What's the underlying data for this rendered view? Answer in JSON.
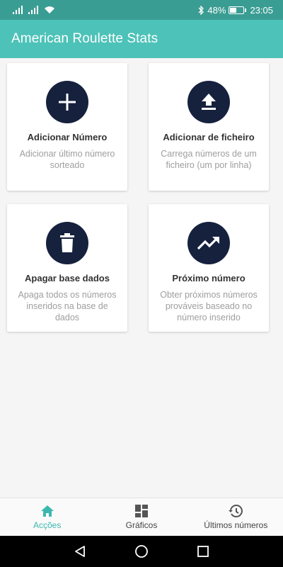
{
  "status_bar": {
    "battery_percent": "48%",
    "battery_level": 0.48,
    "time": "23:05"
  },
  "app_bar": {
    "title": "American Roulette Stats"
  },
  "cards": [
    {
      "title": "Adicionar Número",
      "description": "Adicionar último número sorteado",
      "icon": "plus-icon"
    },
    {
      "title": "Adicionar de ficheiro",
      "description": "Carrega números de um ficheiro (um por linha)",
      "icon": "upload-icon"
    },
    {
      "title": "Apagar base dados",
      "description": "Apaga todos os números inseridos na base de dados",
      "icon": "trash-icon"
    },
    {
      "title": "Próximo número",
      "description": "Obter próximos números prováveis baseado no número inserido",
      "icon": "trending-up-icon"
    }
  ],
  "bottom_nav": {
    "items": [
      {
        "label": "Acções",
        "icon": "home-icon",
        "active": true
      },
      {
        "label": "Gráficos",
        "icon": "dashboard-icon",
        "active": false
      },
      {
        "label": "Últimos números",
        "icon": "history-icon",
        "active": false
      }
    ]
  },
  "colors": {
    "status_bar": "#3a9d93",
    "app_bar": "#4dc2b8",
    "icon_circle": "#16213e",
    "nav_active": "#3ab8ae"
  }
}
